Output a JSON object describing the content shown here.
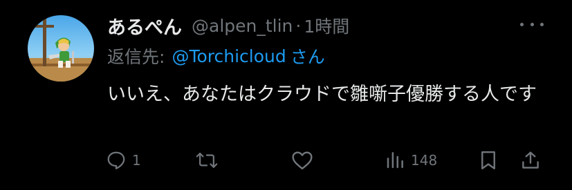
{
  "tweet": {
    "display_name": "あるぺん",
    "handle": "@alpen_tlin",
    "separator": "·",
    "time": "1時間",
    "reply_label": "返信先:",
    "reply_user": "@Torchicloud",
    "reply_suffix": "さん",
    "text": "いいえ、あなたはクラウドで雛噺子優勝する人です"
  },
  "actions": {
    "reply_count": "1",
    "retweet_count": "",
    "like_count": "",
    "views_count": "148"
  },
  "icons": {
    "reply": "reply-icon",
    "retweet": "retweet-icon",
    "like": "heart-icon",
    "views": "views-icon",
    "bookmark": "bookmark-icon",
    "share": "share-icon",
    "more": "more-icon"
  },
  "colors": {
    "background": "#000000",
    "text": "#e7e9ea",
    "muted": "#71767b",
    "link": "#1d9bf0"
  }
}
